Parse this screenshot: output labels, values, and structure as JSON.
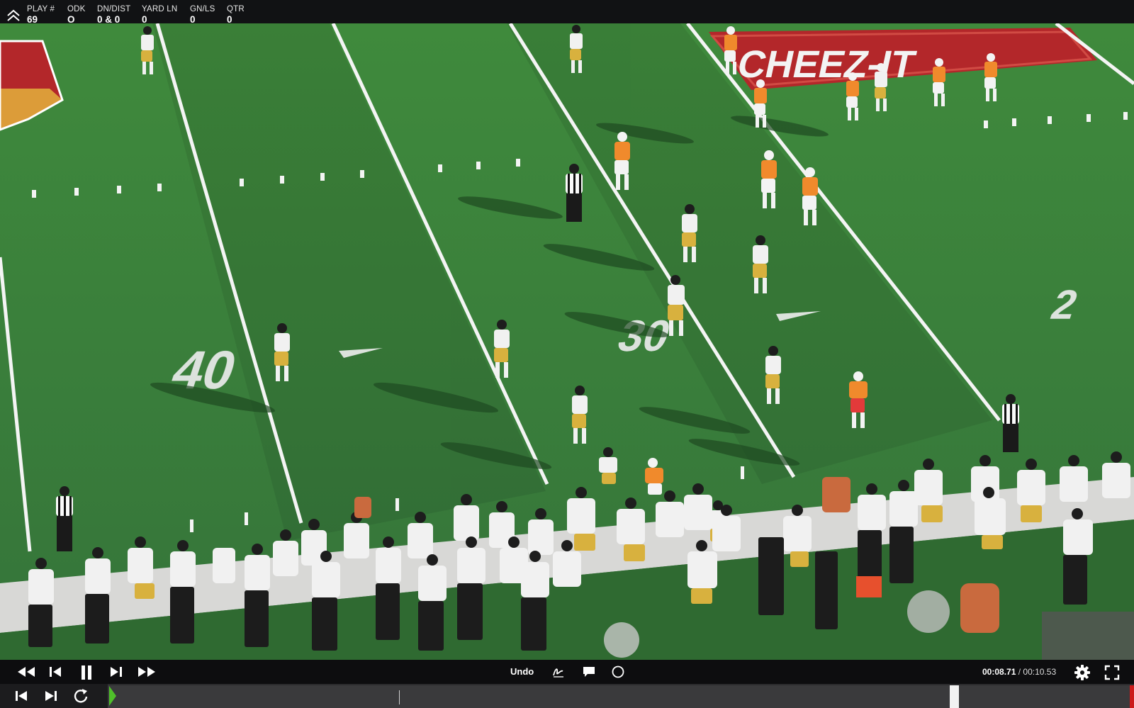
{
  "play_info": {
    "columns": [
      {
        "label": "PLAY #",
        "value": "69"
      },
      {
        "label": "ODK",
        "value": "O"
      },
      {
        "label": "DN/DIST",
        "value": "0 & 0"
      },
      {
        "label": "YARD LN",
        "value": "0"
      },
      {
        "label": "GN/LS",
        "value": "0"
      },
      {
        "label": "QTR",
        "value": "0"
      }
    ]
  },
  "field": {
    "sponsor_logo_text": "CHEEZ-IT",
    "yard_numbers": [
      "40",
      "30",
      "2"
    ]
  },
  "controls": {
    "undo_label": "Undo",
    "current_time": "00:08.71",
    "separator": "/",
    "total_time": "00:10.53"
  },
  "timeline": {
    "progress_fraction": 0.83
  },
  "colors": {
    "turf": "#3d7a3a",
    "playhead_green": "#4fbf2a",
    "accent_red": "#cc1a1a"
  }
}
